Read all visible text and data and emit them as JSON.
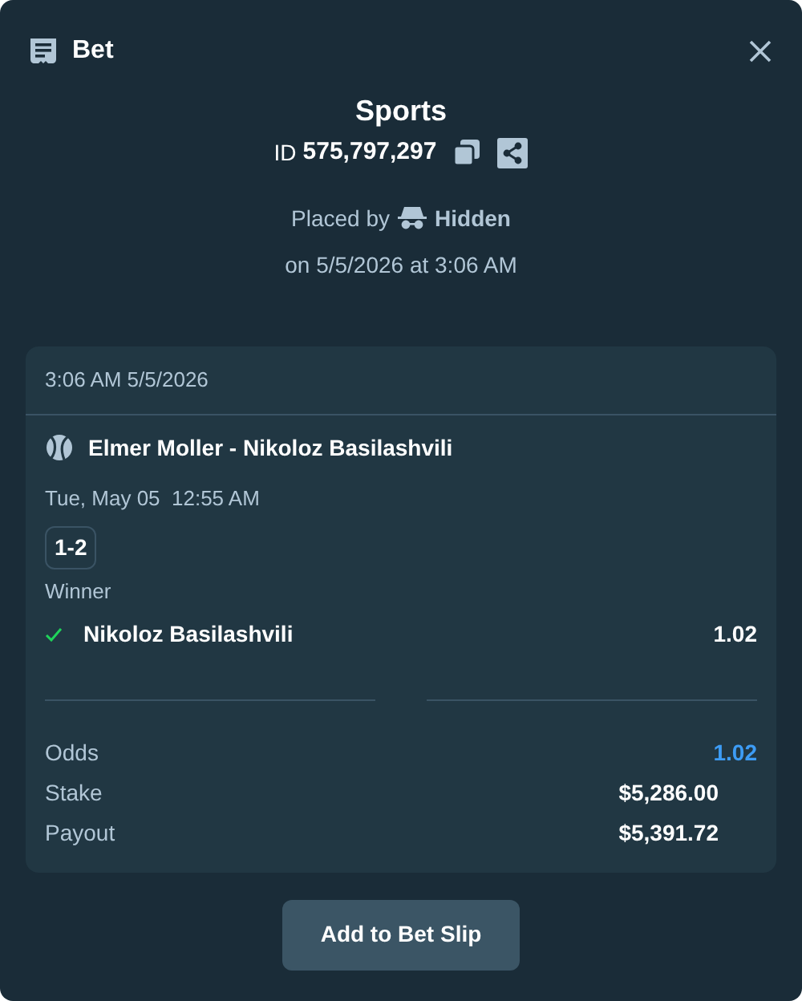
{
  "header": {
    "title": "Bet"
  },
  "summary": {
    "title": "Sports",
    "id_label": "ID",
    "id_value": "575,797,297",
    "placed_by_label": "Placed by",
    "placed_by_user": "Hidden",
    "placed_on": "on 5/5/2026 at 3:06 AM"
  },
  "card": {
    "timestamp": "3:06 AM 5/5/2026",
    "event": "Elmer Moller - Nikoloz Basilashvili",
    "start_time": "Tue, May 05  12:55 AM",
    "score": "1-2",
    "market": "Winner",
    "selection": {
      "name": "Nikoloz Basilashvili",
      "odds": "1.02",
      "won": true
    },
    "totals": [
      {
        "kind": "odds",
        "label": "Odds",
        "value": "1.02"
      },
      {
        "kind": "amount",
        "label": "Stake",
        "value": "$5,286.00"
      },
      {
        "kind": "amount",
        "label": "Payout",
        "value": "$5,391.72"
      }
    ]
  },
  "action": {
    "label": "Add to Bet Slip"
  }
}
